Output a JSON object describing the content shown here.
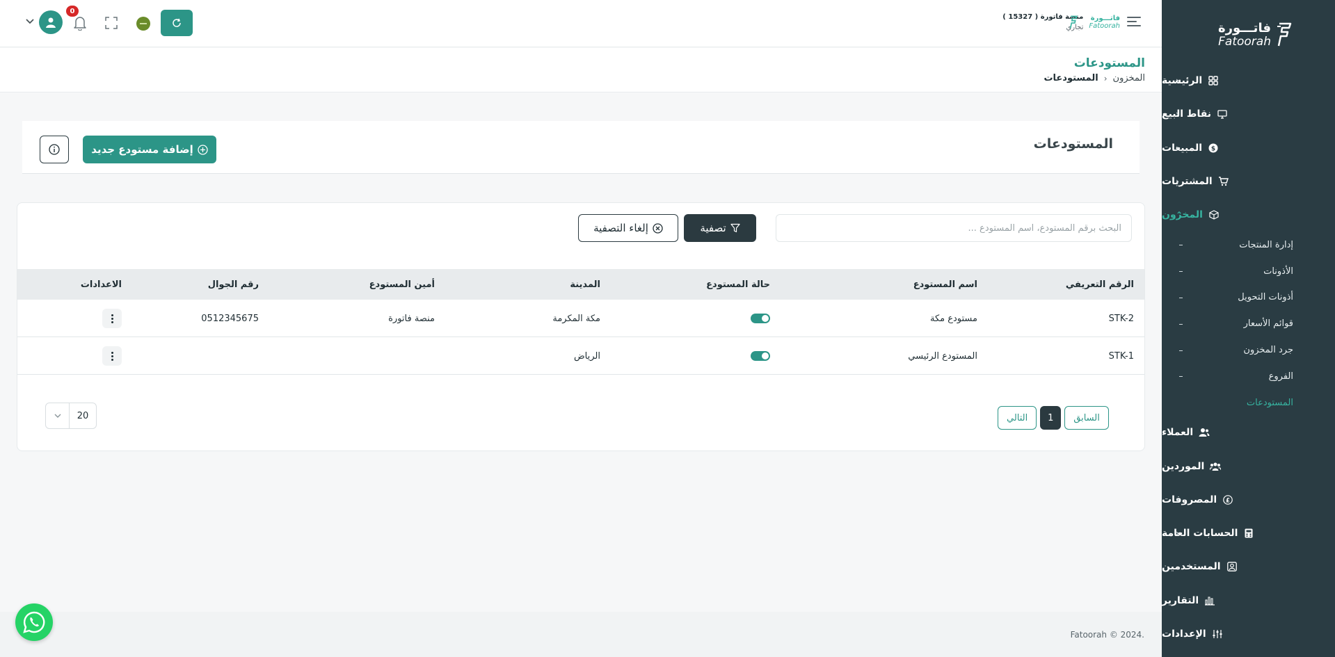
{
  "sidebar": {
    "logo_ar": "فاتـــورة",
    "logo_en": "Fatoorah",
    "items": [
      {
        "label": "الرئيسية",
        "icon": "grid-icon"
      },
      {
        "label": "نقاط البيع",
        "icon": "monitor-icon"
      },
      {
        "label": "المبيعات",
        "icon": "dollar-icon"
      },
      {
        "label": "المشتريات",
        "icon": "cart-icon"
      },
      {
        "label": "المخزون",
        "icon": "box-icon"
      },
      {
        "label": "العملاء",
        "icon": "users-icon"
      },
      {
        "label": "الموردين",
        "icon": "group-icon"
      },
      {
        "label": "المصروفات",
        "icon": "pound-icon"
      },
      {
        "label": "الحسابات العامة",
        "icon": "calculator-icon"
      },
      {
        "label": "المستخدمين",
        "icon": "user-square-icon"
      },
      {
        "label": "التقارير",
        "icon": "chart-icon"
      },
      {
        "label": "الإعدادات",
        "icon": "sliders-icon"
      }
    ],
    "inventory_sub": [
      "إدارة المنتجات",
      "الأذونات",
      "أذونات التحويل",
      "قوائم الأسعار",
      "جرد المخزون",
      "الفروع",
      "المستودعات"
    ]
  },
  "topbar": {
    "brand_mini_ar": "فاتـــورة",
    "brand_mini_en": "Fatoorah",
    "business_name": "منصة فاتورة",
    "business_id": "( 15327 )",
    "business_type": "تجاري",
    "notifications_count": "0"
  },
  "page": {
    "title": "المستودعات",
    "breadcrumb": [
      "المخزون",
      "المستودعات"
    ]
  },
  "card": {
    "title": "المستودعات",
    "add_button": "إضافة مستودع جديد"
  },
  "filters": {
    "search_placeholder": "البحث برقم المستودع، اسم المستودع ...",
    "filter_button": "تصفية",
    "clear_button": "إلغاء التصفية"
  },
  "table": {
    "headers": {
      "id": "الرقم التعريفي",
      "name": "اسم المستودع",
      "status": "حالة المستودع",
      "city": "المدينة",
      "keeper": "أمين المستودع",
      "phone": "رقم الجوال",
      "settings": "الاعدادات"
    },
    "rows": [
      {
        "id": "STK-2",
        "name": "مستودع مكة",
        "status": true,
        "city": "مكة المكرمة",
        "keeper": "منصة فاتورة",
        "phone": "0512345675"
      },
      {
        "id": "STK-1",
        "name": "المستودع الرئيسي",
        "status": true,
        "city": "الرياض",
        "keeper": "",
        "phone": ""
      }
    ]
  },
  "pagination": {
    "prev": "السابق",
    "current": "1",
    "next": "التالي",
    "page_size": "20"
  },
  "footer": {
    "copyright": "Fatoorah © 2024."
  },
  "colors": {
    "sidebar_bg": "#2a3c43",
    "accent": "#2c9587",
    "active_text": "#37b3a0",
    "dark_button": "#2b3a40"
  }
}
